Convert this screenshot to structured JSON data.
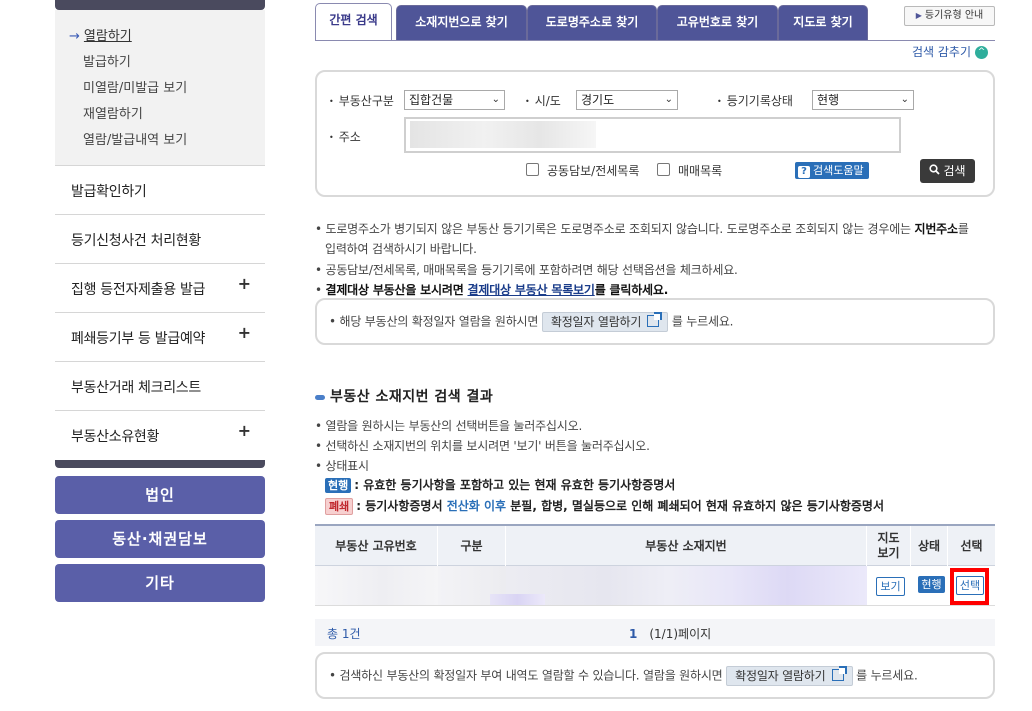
{
  "sidebar": {
    "submenu": [
      {
        "label": "열람하기",
        "active": true
      },
      {
        "label": "발급하기"
      },
      {
        "label": "미열람/미발급 보기"
      },
      {
        "label": "재열람하기"
      },
      {
        "label": "열람/발급내역 보기"
      }
    ],
    "menu": [
      {
        "label": "발급확인하기",
        "expandable": false
      },
      {
        "label": "등기신청사건 처리현황",
        "expandable": false
      },
      {
        "label": "집행 등전자제출용 발급",
        "expandable": true
      },
      {
        "label": "폐쇄등기부 등 발급예약",
        "expandable": true
      },
      {
        "label": "부동산거래 체크리스트",
        "expandable": false
      },
      {
        "label": "부동산소유현황",
        "expandable": true
      }
    ],
    "plus_symbol": "+",
    "arrow_symbol": "→",
    "buttons": [
      "법인",
      "동산·채권담보",
      "기타"
    ]
  },
  "tabs": [
    {
      "label": "간편 검색",
      "active": true
    },
    {
      "label": "소재지번으로 찾기"
    },
    {
      "label": "도로명주소로 찾기"
    },
    {
      "label": "고유번호로 찾기"
    },
    {
      "label": "지도로 찾기"
    }
  ],
  "guide_button": "등기유형 안내",
  "hide_search": {
    "label": "검색 감추기",
    "icon": "^"
  },
  "search": {
    "property_type_label": "부동산구분",
    "property_type_value": "집합건물",
    "region_label": "시/도",
    "region_value": "경기도",
    "record_status_label": "등기기록상태",
    "record_status_value": "현행",
    "address_label": "주소",
    "address_value": "",
    "joint_collateral_label": "공동담보/전세목록",
    "sales_list_label": "매매목록",
    "help_label": "검색도움말",
    "help_icon": "?",
    "search_button": "검색"
  },
  "notices": {
    "line1a": "도로명주소가 병기되지 않은 부동산 등기기록은 도로명주소로 조회되지 않습니다. 도로명주소로 조회되지 않는 경우에는 ",
    "line1b": "지번주소",
    "line1c": "를",
    "line2": "입력하여 검색하시기 바랍니다.",
    "line3": "공동담보/전세목록, 매매목록을 등기기록에 포함하려면 해당 선택옵션을 체크하세요.",
    "line4a": "결제대상 부동산을 보시려면 ",
    "line4_link": "결제대상 부동산 목록보기",
    "line4b": "를 클릭하세요."
  },
  "confirm_box_1": {
    "prefix": "해당 부동산의 확정일자 열람을 원하시면",
    "button": "확정일자 열람하기",
    "suffix": "를 누르세요."
  },
  "results": {
    "title": "부동산 소재지번 검색 결과",
    "guide1": "열람을 원하시는 부동산의 선택버튼을 눌러주십시오.",
    "guide2": "선택하신 소재지번의 위치를 보시려면 '보기' 버튼을 눌러주십시오.",
    "guide3": "상태표시",
    "legend_current_badge": "현행",
    "legend_current_text": ": 유효한 등기사항을 포함하고 있는 현재 유효한 등기사항증명서",
    "legend_closed_badge": "폐쇄",
    "legend_closed_a": ": 등기사항증명서 ",
    "legend_closed_blue": "전산화 이후",
    "legend_closed_b": " 분필, 합병, 멸실등으로 인해 폐쇄되어 현재 유효하지 않은 등기사항증명서",
    "columns": [
      "부동산 고유번호",
      "구분",
      "부동산 소재지번",
      "지도\n보기",
      "상태",
      "선택"
    ],
    "rows": [
      {
        "unique_no": "",
        "type": "",
        "address": "",
        "map_button": "보기",
        "status": "현행",
        "select_button": "선택"
      }
    ],
    "total": "총 1건",
    "current_page": "1",
    "page_info": "(1/1)페이지"
  },
  "confirm_box_2": {
    "prefix": "검색하신 부동산의 확정일자 부여 내역도 열람할 수 있습니다. 열람을 원하시면",
    "button": "확정일자 열람하기",
    "suffix": "를 누르세요."
  },
  "colors": {
    "tab_bg": "#4f5598",
    "side_button_bg": "#5a5fa8",
    "accent_blue": "#2a6fb8",
    "highlight_red": "#ff0000"
  }
}
